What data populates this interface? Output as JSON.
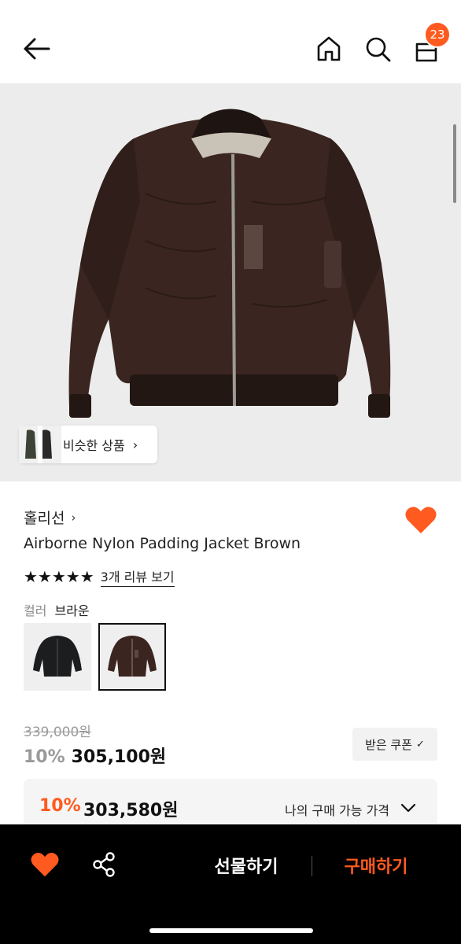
{
  "header": {
    "back_icon": "arrow-left-icon",
    "home_icon": "home-icon",
    "search_icon": "search-icon",
    "bag_icon": "shopping-bag-icon",
    "cart_count": "23"
  },
  "hero": {
    "similar_label": "비슷한 상품"
  },
  "product": {
    "brand": "홀리선",
    "name": "Airborne Nylon Padding Jacket Brown",
    "rating_stars": "★★★★★",
    "rating_value": 5,
    "review_link": "3개 리뷰 보기",
    "color_label": "컬러",
    "color_value": "브라운",
    "swatches": [
      {
        "name": "black",
        "selected": false
      },
      {
        "name": "brown",
        "selected": true
      }
    ]
  },
  "price": {
    "original": "339,000원",
    "discount_pct": "10%",
    "sale": "305,100원",
    "coupon_label": "받은 쿠폰",
    "my_price_pct": "10%",
    "my_price": "303,580원",
    "my_price_label": "나의 구매 가능 가격"
  },
  "bottom_bar": {
    "gift_label": "선물하기",
    "buy_label": "구매하기"
  },
  "colors": {
    "accent": "#ff5a1f",
    "background": "#ffffff",
    "hero_bg": "#ececec",
    "bottom_bar": "#000000"
  }
}
